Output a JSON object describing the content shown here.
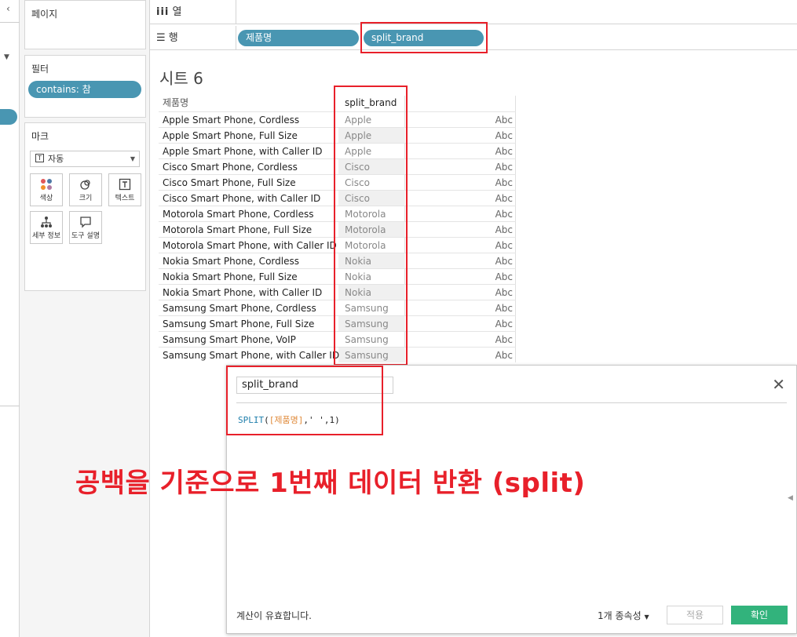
{
  "shelves": {
    "columns_label": "열",
    "rows_label": "행",
    "rows_pills": [
      "제품명",
      "split_brand"
    ]
  },
  "cards": {
    "pages_title": "페이지",
    "filters_title": "필터",
    "filter_pill": "contains: 참",
    "marks_title": "마크",
    "mark_type": "자동",
    "mark_buttons": [
      "색상",
      "크기",
      "텍스트",
      "세부 정보",
      "도구 설명"
    ]
  },
  "sheet": {
    "title": "시트 6",
    "headers": [
      "제품명",
      "split_brand"
    ],
    "rows": [
      {
        "product": "Apple Smart Phone, Cordless",
        "brand": "Apple",
        "mark": "Abc"
      },
      {
        "product": "Apple Smart Phone, Full Size",
        "brand": "Apple",
        "mark": "Abc"
      },
      {
        "product": "Apple Smart Phone, with Caller ID",
        "brand": "Apple",
        "mark": "Abc"
      },
      {
        "product": "Cisco Smart Phone, Cordless",
        "brand": "Cisco",
        "mark": "Abc"
      },
      {
        "product": "Cisco Smart Phone, Full Size",
        "brand": "Cisco",
        "mark": "Abc"
      },
      {
        "product": "Cisco Smart Phone, with Caller ID",
        "brand": "Cisco",
        "mark": "Abc"
      },
      {
        "product": "Motorola Smart Phone, Cordless",
        "brand": "Motorola",
        "mark": "Abc"
      },
      {
        "product": "Motorola Smart Phone, Full Size",
        "brand": "Motorola",
        "mark": "Abc"
      },
      {
        "product": "Motorola Smart Phone, with Caller ID",
        "brand": "Motorola",
        "mark": "Abc"
      },
      {
        "product": "Nokia Smart Phone, Cordless",
        "brand": "Nokia",
        "mark": "Abc"
      },
      {
        "product": "Nokia Smart Phone, Full Size",
        "brand": "Nokia",
        "mark": "Abc"
      },
      {
        "product": "Nokia Smart Phone, with Caller ID",
        "brand": "Nokia",
        "mark": "Abc"
      },
      {
        "product": "Samsung Smart Phone, Cordless",
        "brand": "Samsung",
        "mark": "Abc"
      },
      {
        "product": "Samsung Smart Phone, Full Size",
        "brand": "Samsung",
        "mark": "Abc"
      },
      {
        "product": "Samsung Smart Phone, VoIP",
        "brand": "Samsung",
        "mark": "Abc"
      },
      {
        "product": "Samsung Smart Phone, with Caller ID",
        "brand": "Samsung",
        "mark": "Abc"
      }
    ]
  },
  "calc_dialog": {
    "name": "split_brand",
    "formula": {
      "fn": "SPLIT",
      "open": "(",
      "field": "[제품명]",
      "rest": ",' ',1)"
    },
    "status": "계산이 유효합니다.",
    "dependencies": "1개 종속성",
    "apply_label": "적용",
    "ok_label": "확인"
  },
  "annotation": "공백을 기준으로 1번째 데이터 반환 (split)",
  "colors": {
    "pill": "#4996b2",
    "highlight": "#e8202a",
    "ok_button": "#32b37c"
  }
}
